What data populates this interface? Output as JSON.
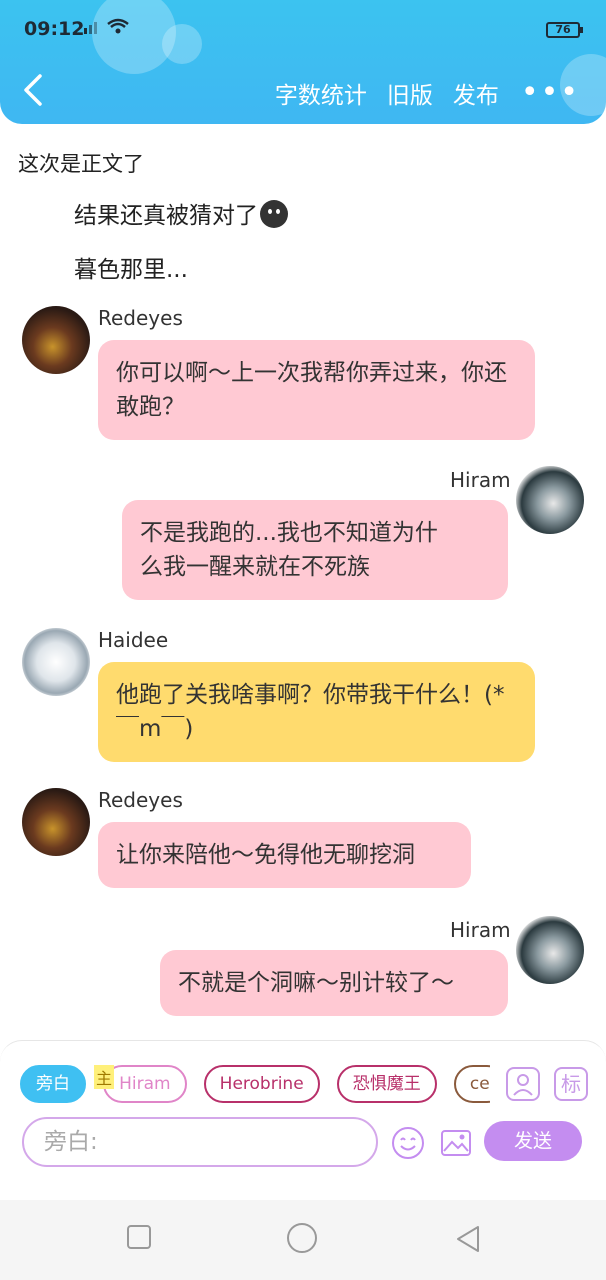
{
  "status_bar": {
    "time": "09:12",
    "battery": "76"
  },
  "header": {
    "actions": [
      "字数统计",
      "旧版",
      "发布"
    ],
    "more": "•••"
  },
  "narration": {
    "lines": [
      "这次是正文了",
      "结果还真被猜对了",
      "暮色那里..."
    ]
  },
  "messages": [
    {
      "sender": "Redeyes",
      "text": "你可以啊～上一次我帮你弄过来，你还敢跑？"
    },
    {
      "sender": "Hiram",
      "text": "不是我跑的...我也不知道为什\n么我一醒来就在不死族"
    },
    {
      "sender": "Haidee",
      "text": "他跑了关我啥事啊？你带我干什么！(*￣m￣)"
    },
    {
      "sender": "Redeyes",
      "text": "让你来陪他～免得他无聊挖洞"
    },
    {
      "sender": "Hiram",
      "text": "不就是个洞嘛～别计较了～"
    }
  ],
  "composer": {
    "owner_tag": "主",
    "chips": [
      "旁白",
      "Hiram",
      "Herobrine",
      "恐惧魔王",
      "ce"
    ],
    "placeholder": "旁白:",
    "send_label": "发送",
    "tag_icon_label": "标",
    "colors": {
      "active": "#3fc0f2",
      "send": "#c48df0",
      "pink_bubble": "#ffc9d3",
      "yellow_bubble": "#ffdb6e"
    }
  }
}
